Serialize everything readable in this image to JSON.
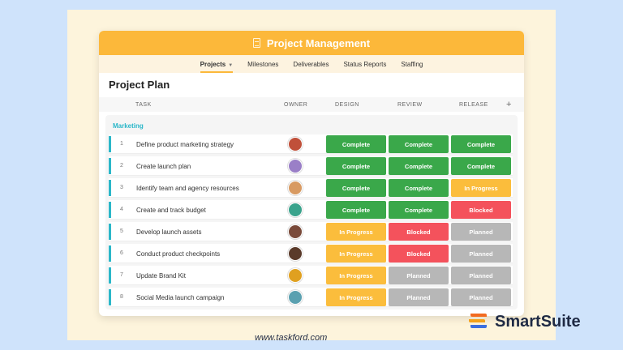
{
  "app": {
    "title": "Project Management"
  },
  "tabs": [
    {
      "label": "Projects",
      "active": true
    },
    {
      "label": "Milestones",
      "active": false
    },
    {
      "label": "Deliverables",
      "active": false
    },
    {
      "label": "Status Reports",
      "active": false
    },
    {
      "label": "Staffing",
      "active": false
    }
  ],
  "page_title": "Project Plan",
  "columns": {
    "task": "TASK",
    "owner": "OWNER",
    "design": "DESIGN",
    "review": "REVIEW",
    "release": "RELEASE",
    "add": "+"
  },
  "group": {
    "name": "Marketing"
  },
  "status_colors": {
    "Complete": "#3aa84a",
    "In Progress": "#fbbd3c",
    "Blocked": "#f4525c",
    "Planned": "#b7b7b7"
  },
  "rows": [
    {
      "num": "1",
      "task": "Define product marketing strategy",
      "owner_color": "#c0503a",
      "design": "Complete",
      "review": "Complete",
      "release": "Complete"
    },
    {
      "num": "2",
      "task": "Create launch plan",
      "owner_color": "#9a7fc7",
      "design": "Complete",
      "review": "Complete",
      "release": "Complete"
    },
    {
      "num": "3",
      "task": "Identify team and agency resources",
      "owner_color": "#d89a62",
      "design": "Complete",
      "review": "Complete",
      "release": "In Progress"
    },
    {
      "num": "4",
      "task": "Create and track budget",
      "owner_color": "#3aa38c",
      "design": "Complete",
      "review": "Complete",
      "release": "Blocked"
    },
    {
      "num": "5",
      "task": "Develop launch assets",
      "owner_color": "#7a4a3a",
      "design": "In Progress",
      "review": "Blocked",
      "release": "Planned"
    },
    {
      "num": "6",
      "task": "Conduct product checkpoints",
      "owner_color": "#5a3a2a",
      "design": "In Progress",
      "review": "Blocked",
      "release": "Planned"
    },
    {
      "num": "7",
      "task": "Update Brand Kit",
      "owner_color": "#e0a020",
      "design": "In Progress",
      "review": "Planned",
      "release": "Planned"
    },
    {
      "num": "8",
      "task": "Social Media launch campaign",
      "owner_color": "#5aa0b0",
      "design": "In Progress",
      "review": "Planned",
      "release": "Planned"
    }
  ],
  "brand": {
    "name": "SmartSuite"
  },
  "footer": {
    "url": "www.taskford.com"
  }
}
